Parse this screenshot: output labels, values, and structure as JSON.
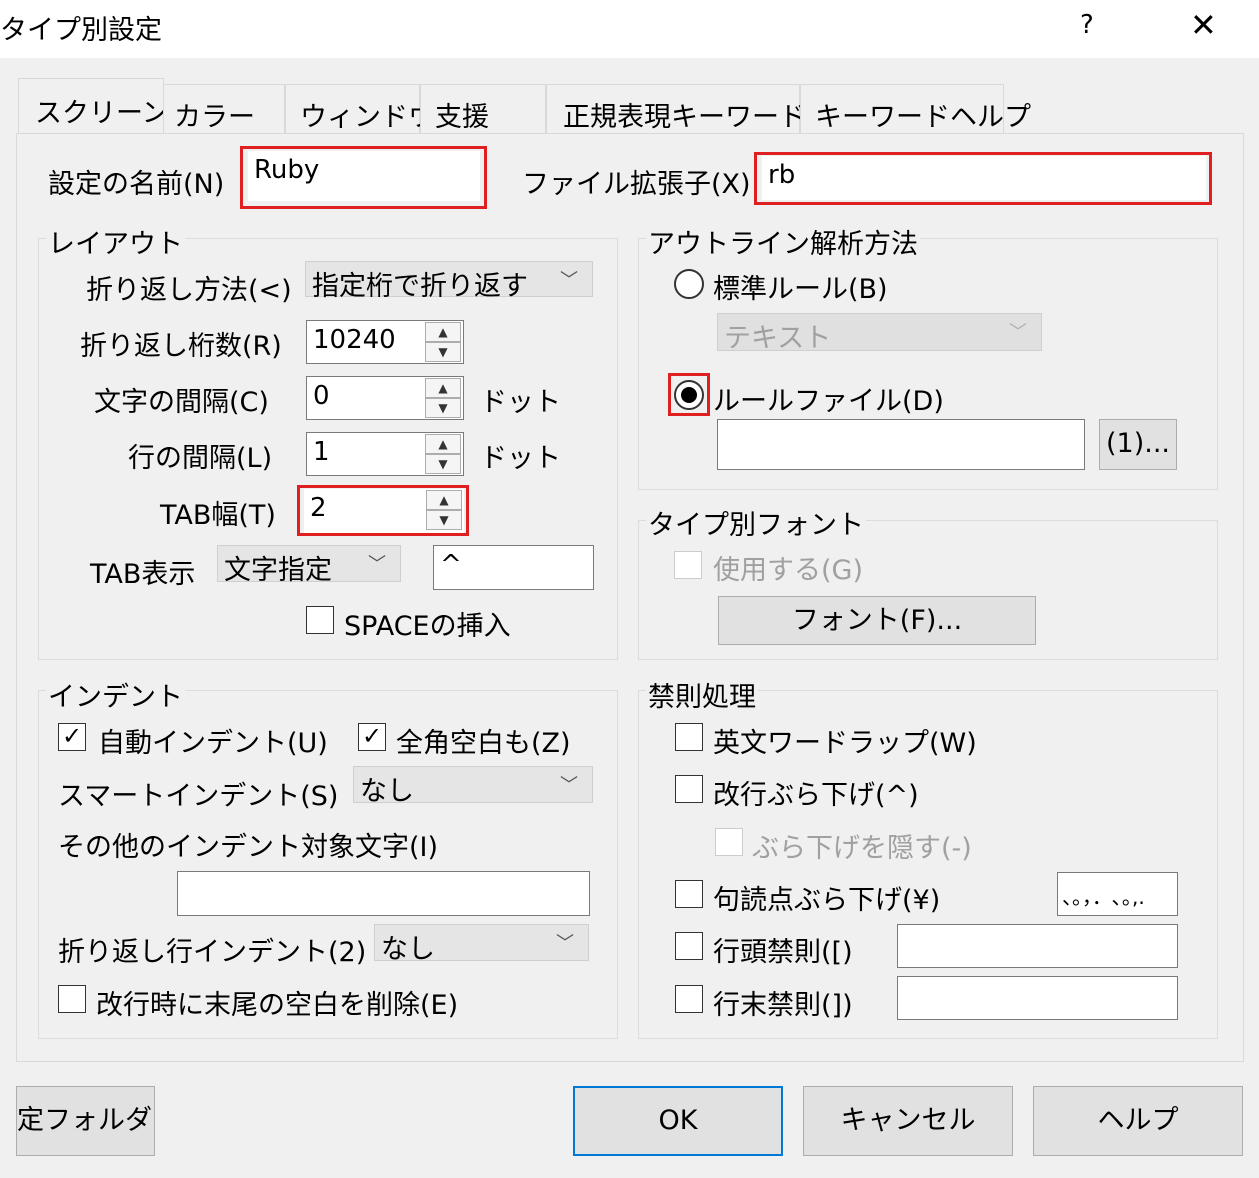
{
  "window": {
    "title": "タイプ別設定",
    "help": "?",
    "close": "✕"
  },
  "tabs": [
    "スクリーン",
    "カラー",
    "ウィンドウ",
    "支援",
    "正規表現キーワード",
    "キーワードヘルプ"
  ],
  "setting_name": {
    "label": "設定の名前(N)",
    "value": "Ruby"
  },
  "file_ext": {
    "label": "ファイル拡張子(X)",
    "value": "rb"
  },
  "layout": {
    "title": "レイアウト",
    "wrap_method": {
      "label": "折り返し方法(<)",
      "value": "指定桁で折り返す"
    },
    "wrap_columns": {
      "label": "折り返し桁数(R)",
      "value": "10240"
    },
    "char_spacing": {
      "label": "文字の間隔(C)",
      "value": "0",
      "unit": "ドット"
    },
    "line_spacing": {
      "label": "行の間隔(L)",
      "value": "1",
      "unit": "ドット"
    },
    "tab_width": {
      "label": "TAB幅(T)",
      "value": "2"
    },
    "tab_display": {
      "label": "TAB表示",
      "mode": "文字指定",
      "char": "^"
    },
    "insert_space": {
      "label": "SPACEの挿入",
      "checked": false
    }
  },
  "outline": {
    "title": "アウトライン解析方法",
    "standard_rule": {
      "label": "標準ルール(B)",
      "selected": false
    },
    "standard_rule_combo": "テキスト",
    "rule_file": {
      "label": "ルールファイル(D)",
      "selected": true
    },
    "rule_file_path": "",
    "rule_file_button": "(1)..."
  },
  "type_font": {
    "title": "タイプ別フォント",
    "use": {
      "label": "使用する(G)",
      "checked": false
    },
    "font_button": "フォント(F)..."
  },
  "indent": {
    "title": "インデント",
    "auto_indent": {
      "label": "自動インデント(U)",
      "checked": true
    },
    "fullwidth_space": {
      "label": "全角空白も(Z)",
      "checked": true
    },
    "smart_indent": {
      "label": "スマートインデント(S)",
      "value": "なし"
    },
    "other_chars": {
      "label": "その他のインデント対象文字(I)",
      "value": ""
    },
    "wrap_indent": {
      "label": "折り返し行インデント(2)",
      "value": "なし"
    },
    "trim_trailing": {
      "label": "改行時に末尾の空白を削除(E)",
      "checked": false
    }
  },
  "kinsoku": {
    "title": "禁則処理",
    "word_wrap": {
      "label": "英文ワードラップ(W)",
      "checked": false
    },
    "newline_hang": {
      "label": "改行ぶら下げ(^)",
      "checked": false
    },
    "hide_hang": {
      "label": "ぶら下げを隠す(-)",
      "checked": false
    },
    "punct_hang": {
      "label": "句読点ぶら下げ(¥)",
      "checked": false,
      "chars": "、。，．､｡,."
    },
    "line_head": {
      "label": "行頭禁則([)",
      "value": ""
    },
    "line_tail": {
      "label": "行末禁則(])",
      "value": ""
    }
  },
  "footer": {
    "settings_folder": "定フォルダ(/)",
    "ok": "OK",
    "cancel": "キャンセル",
    "help": "ヘルプ"
  },
  "colors": {
    "highlight": "#e02020",
    "default_button_border": "#0078d7"
  }
}
